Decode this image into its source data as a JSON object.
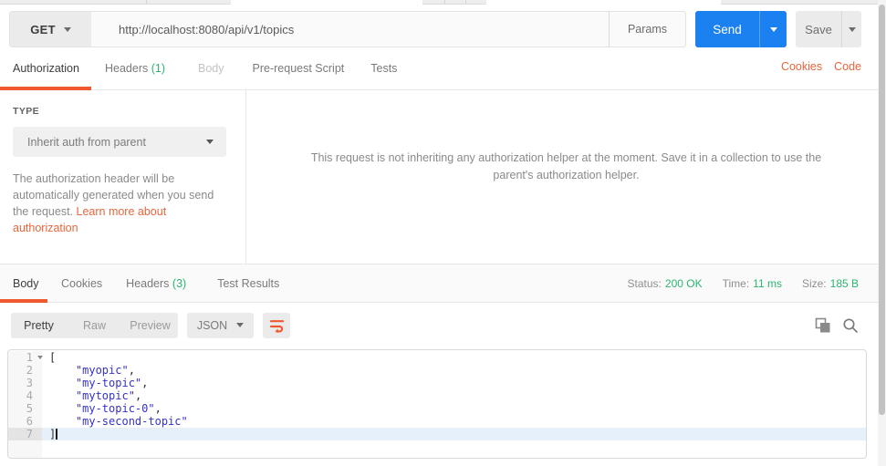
{
  "colors": {
    "accent_orange": "#f0582f",
    "link_orange": "#e8663d",
    "primary_blue": "#1b80f0",
    "success_green": "#2cb570",
    "json_string": "#3632c8"
  },
  "request_bar": {
    "method": "GET",
    "url": "http://localhost:8080/api/v1/topics",
    "params_label": "Params",
    "send_label": "Send",
    "save_label": "Save"
  },
  "request_tabs": {
    "authorization": "Authorization",
    "headers": "Headers",
    "headers_count": "(1)",
    "body": "Body",
    "pre_request": "Pre-request Script",
    "tests": "Tests",
    "cookies_link": "Cookies",
    "code_link": "Code"
  },
  "auth": {
    "type_label": "TYPE",
    "type_value": "Inherit auth from parent",
    "description": "The authorization header will be automatically generated when you send the request. ",
    "learn_link": "Learn more about authorization",
    "message": "This request is not inheriting any authorization helper at the moment. Save it in a collection to use the parent's authorization helper."
  },
  "response": {
    "tabs": {
      "body": "Body",
      "cookies": "Cookies",
      "headers": "Headers",
      "headers_count": "(3)",
      "test_results": "Test Results"
    },
    "status": {
      "label": "Status:",
      "value": "200 OK"
    },
    "time": {
      "label": "Time:",
      "value": "11 ms"
    },
    "size": {
      "label": "Size:",
      "value": "185 B"
    },
    "view_modes": {
      "pretty": "Pretty",
      "raw": "Raw",
      "preview": "Preview"
    },
    "language": "JSON"
  },
  "body_editor": {
    "lines": [
      {
        "num": "1",
        "code": "["
      },
      {
        "num": "2",
        "indent": "    ",
        "str": "\"myopic\"",
        "punct": ","
      },
      {
        "num": "3",
        "indent": "    ",
        "str": "\"my-topic\"",
        "punct": ","
      },
      {
        "num": "4",
        "indent": "    ",
        "str": "\"mytopic\"",
        "punct": ","
      },
      {
        "num": "5",
        "indent": "    ",
        "str": "\"my-topic-0\"",
        "punct": ","
      },
      {
        "num": "6",
        "indent": "    ",
        "str": "\"my-second-topic\"",
        "punct": ""
      },
      {
        "num": "7",
        "code": "]"
      }
    ]
  }
}
